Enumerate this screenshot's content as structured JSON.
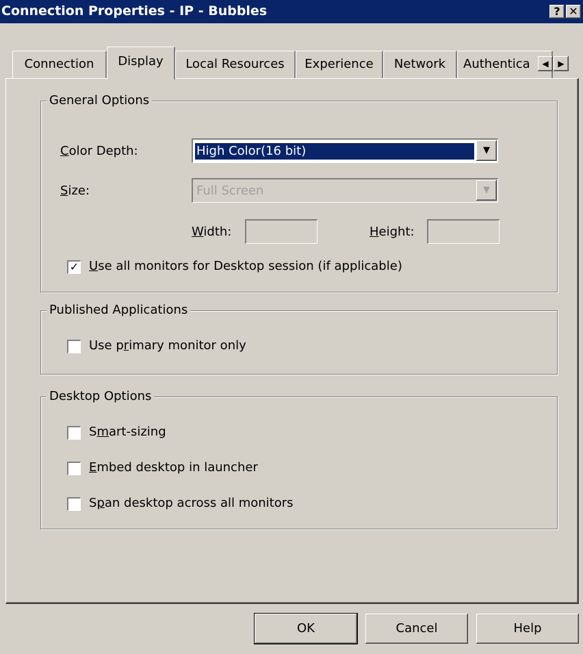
{
  "window": {
    "title": "Connection Properties - IP - Bubbles",
    "help_glyph": "?",
    "close_glyph": "✕"
  },
  "tabs": [
    {
      "label": "Connection"
    },
    {
      "label": "Display",
      "active": true
    },
    {
      "label": "Local Resources"
    },
    {
      "label": "Experience"
    },
    {
      "label": "Network"
    },
    {
      "label": "Authentica"
    }
  ],
  "tab_scroll": {
    "left_glyph": "◀",
    "right_glyph": "▶"
  },
  "general_options": {
    "title": "General Options",
    "color_depth": {
      "label_u": "C",
      "label_rest": "olor Depth:",
      "value": "High Color(16 bit)"
    },
    "size": {
      "label_u": "S",
      "label_rest": "ize:",
      "value": "Full Screen"
    },
    "width": {
      "label_u": "W",
      "label_rest": "idth:",
      "value": ""
    },
    "height": {
      "label_u": "H",
      "label_rest": "eight:",
      "value": ""
    },
    "all_monitors": {
      "label_u": "U",
      "label_rest": "se all monitors for Desktop session (if applicable)",
      "checked": true
    }
  },
  "published_applications": {
    "title": "Published Applications",
    "primary_monitor": {
      "label_pre": "Use p",
      "label_u": "r",
      "label_rest": "imary monitor only",
      "checked": false
    }
  },
  "desktop_options": {
    "title": "Desktop Options",
    "smart_sizing": {
      "label_pre": "S",
      "label_u": "m",
      "label_rest": "art-sizing",
      "checked": false
    },
    "embed_desktop": {
      "label_pre": "",
      "label_u": "E",
      "label_rest": "mbed desktop in launcher",
      "checked": false
    },
    "span_desktop": {
      "label_pre": "S",
      "label_u": "p",
      "label_rest": "an desktop across all monitors",
      "checked": false
    }
  },
  "buttons": {
    "ok": "OK",
    "cancel": "Cancel",
    "help": "Help"
  },
  "check_glyph": "✓",
  "combo_arrow_glyph": "▼"
}
